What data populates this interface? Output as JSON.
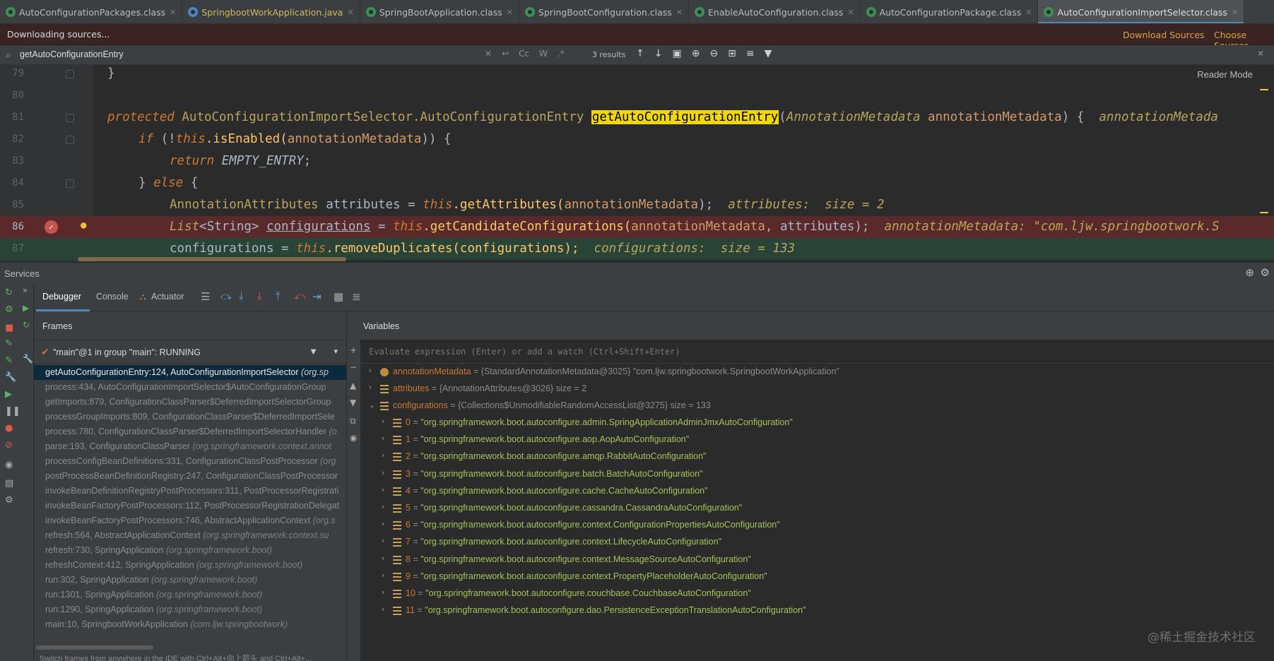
{
  "tabs": [
    {
      "label": "AutoConfigurationPackages.class",
      "kind": "class",
      "active": false
    },
    {
      "label": "SpringbootWorkApplication.java",
      "kind": "java",
      "active": false
    },
    {
      "label": "SpringBootApplication.class",
      "kind": "class",
      "active": false
    },
    {
      "label": "SpringBootConfiguration.class",
      "kind": "class",
      "active": false
    },
    {
      "label": "EnableAutoConfiguration.class",
      "kind": "class",
      "active": false
    },
    {
      "label": "AutoConfigurationPackage.class",
      "kind": "class",
      "active": false
    },
    {
      "label": "AutoConfigurationImportSelector.class",
      "kind": "class",
      "active": true
    }
  ],
  "notice": {
    "text": "Downloading sources...",
    "download_sources": "Download Sources",
    "choose_sources": "Choose Sources..."
  },
  "search": {
    "query": "getAutoConfigurationEntry",
    "results": "3 results",
    "opt_case": "Cc",
    "opt_word": "W",
    "opt_regex": ".*"
  },
  "editor": {
    "reader_mode": "Reader Mode",
    "line_numbers": [
      "79",
      "80",
      "81",
      "82",
      "83",
      "84",
      "85",
      "86",
      "87"
    ]
  },
  "code": {
    "l79_brace": "}",
    "l81_protected": "protected",
    "l81_type": "AutoConfigurationImportSelector.AutoConfigurationEntry",
    "l81_method": "getAutoConfigurationEntry",
    "l81_ptype": "AnnotationMetadata",
    "l81_pname": "annotationMetadata",
    "l81_tail": ") {",
    "l81_inline": "annotationMetada",
    "l82_if": "if",
    "l82_not": " (!",
    "l82_this": "this",
    "l82_call": ".isEnabled(",
    "l82_arg": "annotationMetadata",
    "l82_tail": ")) {",
    "l83_return": "return",
    "l83_value": "EMPTY_ENTRY",
    "l84_close": "} ",
    "l84_else": "else",
    "l84_open": " {",
    "l85_type": "AnnotationAttributes",
    "l85_var": " attributes = ",
    "l85_this": "this",
    "l85_call": ".getAttributes(",
    "l85_arg": "annotationMetadata",
    "l85_tail": ");",
    "l85_inline": "attributes:  size = 2",
    "l86_list": "List",
    "l86_generic": "<String> ",
    "l86_var": "configurations",
    "l86_eq": " = ",
    "l86_this": "this",
    "l86_call": ".getCandidateConfigurations(",
    "l86_arg": "annotationMetadata",
    "l86_rest": ", attributes);",
    "l86_inline": "annotationMetadata: \"com.ljw.springbootwork.S",
    "l87_a": "configurations = ",
    "l87_this": "this",
    "l87_call": ".removeDuplicates(configurations);",
    "l87_inline": "configurations:  size = 133"
  },
  "services": {
    "title": "Services"
  },
  "debugger": {
    "tab_debugger": "Debugger",
    "tab_console": "Console",
    "tab_actuator": "Actuator"
  },
  "frames": {
    "title": "Frames",
    "thread": "\"main\"@1 in group \"main\": RUNNING",
    "items": [
      {
        "fn": "getAutoConfigurationEntry:124, AutoConfigurationImportSelector",
        "pkg": "(org.sp"
      },
      {
        "fn": "process:434, AutoConfigurationImportSelector$AutoConfigurationGroup",
        "pkg": ""
      },
      {
        "fn": "getImports:879, ConfigurationClassParser$DeferredImportSelectorGroup",
        "pkg": ""
      },
      {
        "fn": "processGroupImports:809, ConfigurationClassParser$DeferredImportSele",
        "pkg": ""
      },
      {
        "fn": "process:780, ConfigurationClassParser$DeferredImportSelectorHandler",
        "pkg": "(o"
      },
      {
        "fn": "parse:193, ConfigurationClassParser",
        "pkg": "(org.springframework.context.annot"
      },
      {
        "fn": "processConfigBeanDefinitions:331, ConfigurationClassPostProcessor",
        "pkg": "(org"
      },
      {
        "fn": "postProcessBeanDefinitionRegistry:247, ConfigurationClassPostProcessor",
        "pkg": ""
      },
      {
        "fn": "invokeBeanDefinitionRegistryPostProcessors:311, PostProcessorRegistrati",
        "pkg": ""
      },
      {
        "fn": "invokeBeanFactoryPostProcessors:112, PostProcessorRegistrationDelegat",
        "pkg": ""
      },
      {
        "fn": "invokeBeanFactoryPostProcessors:746, AbstractApplicationContext",
        "pkg": "(org.s"
      },
      {
        "fn": "refresh:564, AbstractApplicationContext",
        "pkg": "(org.springframework.context.su"
      },
      {
        "fn": "refresh:730, SpringApplication",
        "pkg": "(org.springframework.boot)"
      },
      {
        "fn": "refreshContext:412, SpringApplication",
        "pkg": "(org.springframework.boot)"
      },
      {
        "fn": "run:302, SpringApplication",
        "pkg": "(org.springframework.boot)"
      },
      {
        "fn": "run:1301, SpringApplication",
        "pkg": "(org.springframework.boot)"
      },
      {
        "fn": "run:1290, SpringApplication",
        "pkg": "(org.springframework.boot)"
      },
      {
        "fn": "main:10, SpringbootWorkApplication",
        "pkg": "(com.ljw.springbootwork)"
      }
    ],
    "hint": "Switch frames from anywhere in the IDE with Ctrl+Alt+向上箭头 and Ctrl+Alt+..."
  },
  "variables": {
    "title": "Variables",
    "eval_placeholder": "Evaluate expression (Enter) or add a watch (Ctrl+Shift+Enter)",
    "items": [
      {
        "name": "annotationMetadata",
        "value": "{StandardAnnotationMetadata@3025} \"com.ljw.springbootwork.SpringbootWorkApplication\""
      },
      {
        "name": "attributes",
        "value": "{AnnotationAttributes@3026}  size = 2"
      },
      {
        "name": "configurations",
        "value": "{Collections$UnmodifiableRandomAccessList@3275}  size = 133"
      }
    ],
    "children": [
      {
        "idx": "0",
        "value": "\"org.springframework.boot.autoconfigure.admin.SpringApplicationAdminJmxAutoConfiguration\""
      },
      {
        "idx": "1",
        "value": "\"org.springframework.boot.autoconfigure.aop.AopAutoConfiguration\""
      },
      {
        "idx": "2",
        "value": "\"org.springframework.boot.autoconfigure.amqp.RabbitAutoConfiguration\""
      },
      {
        "idx": "3",
        "value": "\"org.springframework.boot.autoconfigure.batch.BatchAutoConfiguration\""
      },
      {
        "idx": "4",
        "value": "\"org.springframework.boot.autoconfigure.cache.CacheAutoConfiguration\""
      },
      {
        "idx": "5",
        "value": "\"org.springframework.boot.autoconfigure.cassandra.CassandraAutoConfiguration\""
      },
      {
        "idx": "6",
        "value": "\"org.springframework.boot.autoconfigure.context.ConfigurationPropertiesAutoConfiguration\""
      },
      {
        "idx": "7",
        "value": "\"org.springframework.boot.autoconfigure.context.LifecycleAutoConfiguration\""
      },
      {
        "idx": "8",
        "value": "\"org.springframework.boot.autoconfigure.context.MessageSourceAutoConfiguration\""
      },
      {
        "idx": "9",
        "value": "\"org.springframework.boot.autoconfigure.context.PropertyPlaceholderAutoConfiguration\""
      },
      {
        "idx": "10",
        "value": "\"org.springframework.boot.autoconfigure.couchbase.CouchbaseAutoConfiguration\""
      },
      {
        "idx": "11",
        "value": "\"org.springframework.boot.autoconfigure.dao.PersistenceExceptionTranslationAutoConfiguration\""
      }
    ],
    "eq": "="
  },
  "watermark": "@稀土掘金技术社区"
}
